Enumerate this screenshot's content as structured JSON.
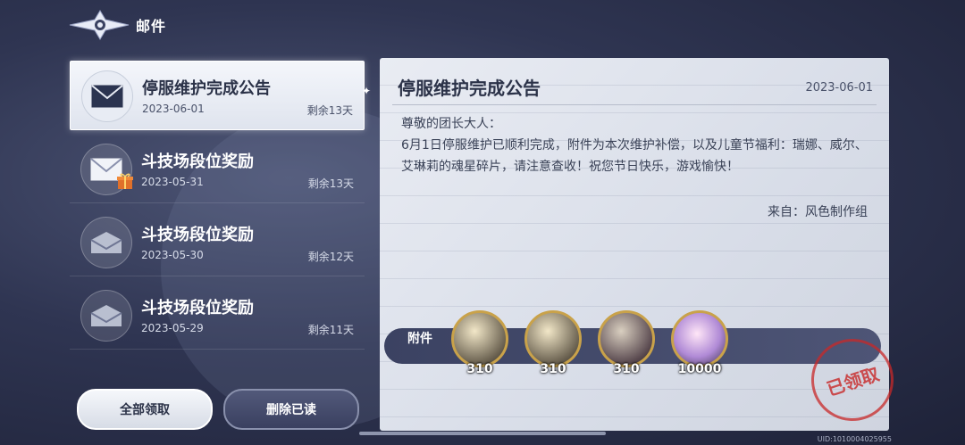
{
  "header": {
    "title": "邮件",
    "emblem_icon": "winged-emblem-icon"
  },
  "mails": [
    {
      "title": "停服维护完成公告",
      "date": "2023-06-01",
      "remain": "剩余13天",
      "icon": "envelope-icon",
      "gift": false
    },
    {
      "title": "斗技场段位奖励",
      "date": "2023-05-31",
      "remain": "剩余13天",
      "icon": "envelope-icon",
      "gift": true
    },
    {
      "title": "斗技场段位奖励",
      "date": "2023-05-30",
      "remain": "剩余12天",
      "icon": "envelope-open-icon",
      "gift": false
    },
    {
      "title": "斗技场段位奖励",
      "date": "2023-05-29",
      "remain": "剩余11天",
      "icon": "envelope-open-icon",
      "gift": false
    }
  ],
  "buttons": {
    "claim_all": "全部领取",
    "delete_read": "删除已读"
  },
  "detail": {
    "title": "停服维护完成公告",
    "date": "2023-06-01",
    "greeting": "尊敬的团长大人：",
    "body": "6月1日停服维护已顺利完成，附件为本次维护补偿，以及儿童节福利：瑞娜、威尔、艾琳莉的魂星碎片，请注意查收！祝您节日快乐，游戏愉快！",
    "sign": "来自：风色制作组"
  },
  "attachments": {
    "label": "附件",
    "items": [
      {
        "name": "character-shard-1",
        "qty": "310"
      },
      {
        "name": "character-shard-2",
        "qty": "310"
      },
      {
        "name": "character-shard-3",
        "qty": "310"
      },
      {
        "name": "diamond",
        "qty": "10000"
      }
    ]
  },
  "stamp": "已领取",
  "uid": "UID:1010004025955",
  "colors": {
    "accent_gold": "#c9a24a",
    "stamp_red": "#c82828"
  }
}
